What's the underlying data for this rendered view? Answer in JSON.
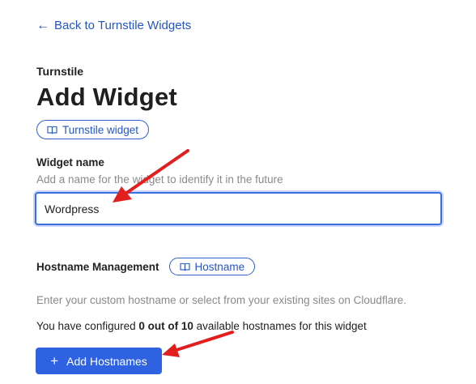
{
  "back_link": {
    "label": "Back to Turnstile Widgets"
  },
  "header": {
    "eyebrow": "Turnstile",
    "title": "Add Widget",
    "doc_pill": "Turnstile widget"
  },
  "widget_name": {
    "label": "Widget name",
    "help": "Add a name for the widget to identify it in the future",
    "value": "Wordpress"
  },
  "hostname": {
    "label": "Hostname Management",
    "doc_pill": "Hostname",
    "description": "Enter your custom hostname or select from your existing sites on Cloudflare.",
    "count_prefix": "You have configured ",
    "count_value": "0 out of 10",
    "count_suffix": " available hostnames for this widget",
    "add_button": "Add Hostnames"
  },
  "colors": {
    "link": "#2455c3",
    "primary_button": "#2f62e0",
    "annotation_arrow": "#e31e1e"
  },
  "icons": {
    "back": "arrow-left-icon",
    "doc": "book-icon",
    "add": "plus-icon"
  }
}
